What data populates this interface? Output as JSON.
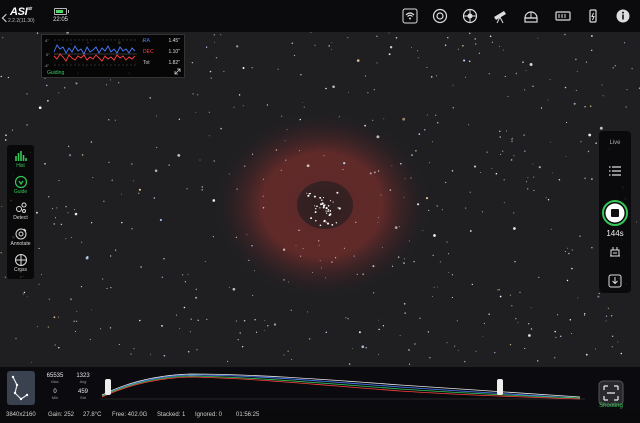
{
  "app": {
    "logo": "ASI",
    "logo_sub": "air",
    "version": "2.2.2(11.30)"
  },
  "status": {
    "time": "22:05",
    "battery_level": 0.8
  },
  "top_icons": [
    "wifi-icon",
    "lens-icon",
    "mount-icon",
    "telescope-icon",
    "observatory-icon",
    "storage-icon",
    "power-icon",
    "info-icon"
  ],
  "guide": {
    "ra_label": "RA",
    "ra_value": "1.45\"",
    "dec_label": "DEC",
    "dec_value": "1.10\"",
    "tot_label": "Tot",
    "tot_value": "1.82\"",
    "state": "Guiding",
    "y_ticks": [
      "4\"",
      "0\"",
      "-4\""
    ]
  },
  "left_tools": [
    {
      "name": "hist",
      "label": "Hist"
    },
    {
      "name": "guide",
      "label": "Guide"
    },
    {
      "name": "detect",
      "label": "Detect"
    },
    {
      "name": "annotate",
      "label": "Annotate"
    },
    {
      "name": "cross",
      "label": "Cross"
    }
  ],
  "right": {
    "mode": "Live",
    "timer": "144s"
  },
  "histogram": {
    "max": "65535",
    "max_label": "Max",
    "avg": "1323",
    "avg_label": "Avg",
    "min": "0",
    "min_label": "Min",
    "std": "459",
    "std_label": "Std",
    "left_marker": "555",
    "mid_marker": "2785",
    "right_marker": "5014"
  },
  "shooting": {
    "label": "Shooting"
  },
  "footer": {
    "resolution": "3840x2160",
    "gain": "Gain: 252",
    "temp": "27.8°C",
    "free": "Free: 402.0G",
    "stacked": "Stacked: 1",
    "ignored": "Ignored: 0",
    "elapsed": "01:56:25"
  },
  "colors": {
    "accent": "#34c759",
    "ra": "#4a7cff",
    "dec": "#ff4040",
    "nebula": "#8b2a2a"
  }
}
